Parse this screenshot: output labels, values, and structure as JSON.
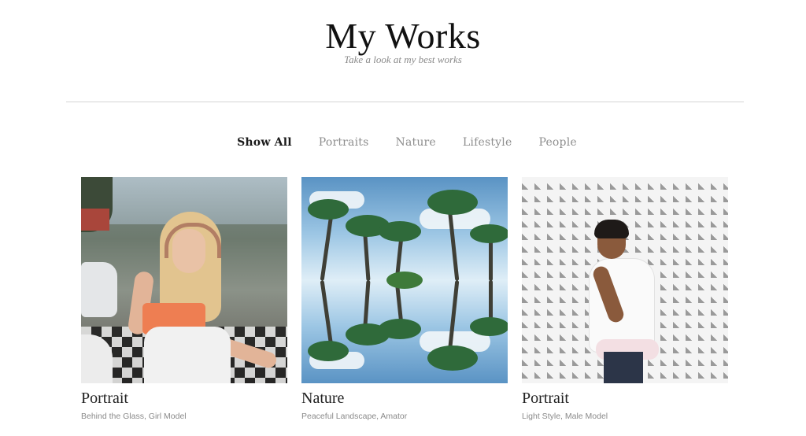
{
  "header": {
    "title": "My Works",
    "subtitle": "Take a look at my best works"
  },
  "filters": [
    {
      "label": "Show All",
      "active": true
    },
    {
      "label": "Portraits",
      "active": false
    },
    {
      "label": "Nature",
      "active": false
    },
    {
      "label": "Lifestyle",
      "active": false
    },
    {
      "label": "People",
      "active": false
    }
  ],
  "works": [
    {
      "title": "Portrait",
      "subtitle": "Behind the Glass, Girl Model",
      "image": "woman-with-headphones-photo"
    },
    {
      "title": "Nature",
      "subtitle": "Peaceful Landscape, Amator",
      "image": "palm-trees-reflection-photo"
    },
    {
      "title": "Portrait",
      "subtitle": "Light Style, Male Model",
      "image": "man-patterned-wall-photo"
    }
  ],
  "colors": {
    "background": "#ffffff",
    "text_primary": "#1a1a1a",
    "text_muted": "#8e8e8e",
    "divider": "#d4d4d4"
  }
}
